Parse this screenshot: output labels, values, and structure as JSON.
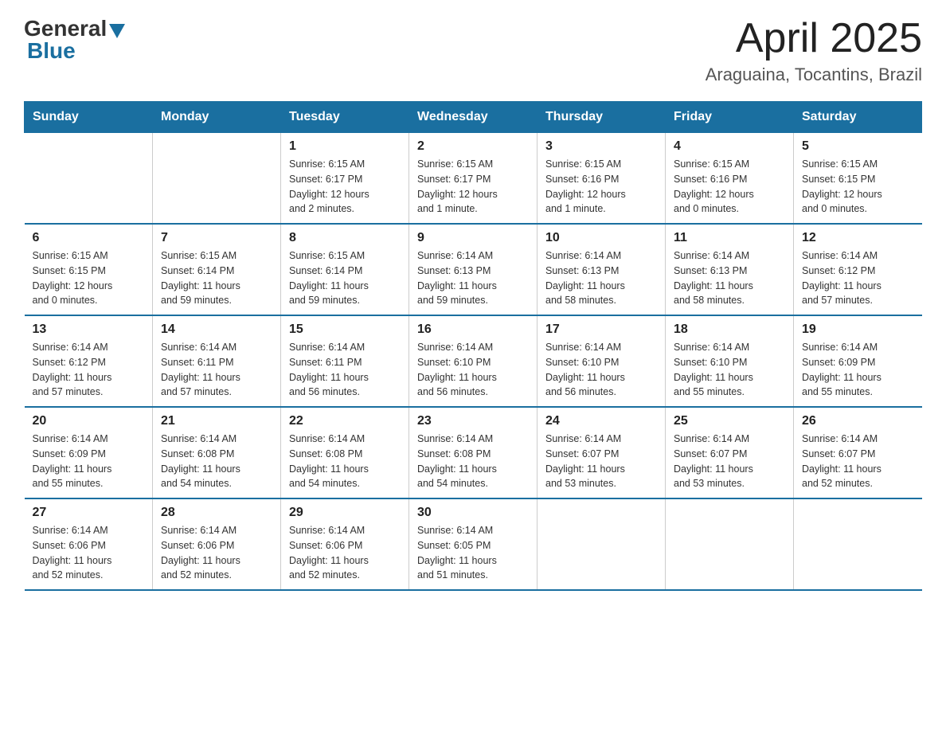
{
  "header": {
    "logo_general": "General",
    "logo_blue": "Blue",
    "month_year": "April 2025",
    "location": "Araguaina, Tocantins, Brazil"
  },
  "days_of_week": [
    "Sunday",
    "Monday",
    "Tuesday",
    "Wednesday",
    "Thursday",
    "Friday",
    "Saturday"
  ],
  "weeks": [
    [
      {
        "day": "",
        "info": ""
      },
      {
        "day": "",
        "info": ""
      },
      {
        "day": "1",
        "info": "Sunrise: 6:15 AM\nSunset: 6:17 PM\nDaylight: 12 hours\nand 2 minutes."
      },
      {
        "day": "2",
        "info": "Sunrise: 6:15 AM\nSunset: 6:17 PM\nDaylight: 12 hours\nand 1 minute."
      },
      {
        "day": "3",
        "info": "Sunrise: 6:15 AM\nSunset: 6:16 PM\nDaylight: 12 hours\nand 1 minute."
      },
      {
        "day": "4",
        "info": "Sunrise: 6:15 AM\nSunset: 6:16 PM\nDaylight: 12 hours\nand 0 minutes."
      },
      {
        "day": "5",
        "info": "Sunrise: 6:15 AM\nSunset: 6:15 PM\nDaylight: 12 hours\nand 0 minutes."
      }
    ],
    [
      {
        "day": "6",
        "info": "Sunrise: 6:15 AM\nSunset: 6:15 PM\nDaylight: 12 hours\nand 0 minutes."
      },
      {
        "day": "7",
        "info": "Sunrise: 6:15 AM\nSunset: 6:14 PM\nDaylight: 11 hours\nand 59 minutes."
      },
      {
        "day": "8",
        "info": "Sunrise: 6:15 AM\nSunset: 6:14 PM\nDaylight: 11 hours\nand 59 minutes."
      },
      {
        "day": "9",
        "info": "Sunrise: 6:14 AM\nSunset: 6:13 PM\nDaylight: 11 hours\nand 59 minutes."
      },
      {
        "day": "10",
        "info": "Sunrise: 6:14 AM\nSunset: 6:13 PM\nDaylight: 11 hours\nand 58 minutes."
      },
      {
        "day": "11",
        "info": "Sunrise: 6:14 AM\nSunset: 6:13 PM\nDaylight: 11 hours\nand 58 minutes."
      },
      {
        "day": "12",
        "info": "Sunrise: 6:14 AM\nSunset: 6:12 PM\nDaylight: 11 hours\nand 57 minutes."
      }
    ],
    [
      {
        "day": "13",
        "info": "Sunrise: 6:14 AM\nSunset: 6:12 PM\nDaylight: 11 hours\nand 57 minutes."
      },
      {
        "day": "14",
        "info": "Sunrise: 6:14 AM\nSunset: 6:11 PM\nDaylight: 11 hours\nand 57 minutes."
      },
      {
        "day": "15",
        "info": "Sunrise: 6:14 AM\nSunset: 6:11 PM\nDaylight: 11 hours\nand 56 minutes."
      },
      {
        "day": "16",
        "info": "Sunrise: 6:14 AM\nSunset: 6:10 PM\nDaylight: 11 hours\nand 56 minutes."
      },
      {
        "day": "17",
        "info": "Sunrise: 6:14 AM\nSunset: 6:10 PM\nDaylight: 11 hours\nand 56 minutes."
      },
      {
        "day": "18",
        "info": "Sunrise: 6:14 AM\nSunset: 6:10 PM\nDaylight: 11 hours\nand 55 minutes."
      },
      {
        "day": "19",
        "info": "Sunrise: 6:14 AM\nSunset: 6:09 PM\nDaylight: 11 hours\nand 55 minutes."
      }
    ],
    [
      {
        "day": "20",
        "info": "Sunrise: 6:14 AM\nSunset: 6:09 PM\nDaylight: 11 hours\nand 55 minutes."
      },
      {
        "day": "21",
        "info": "Sunrise: 6:14 AM\nSunset: 6:08 PM\nDaylight: 11 hours\nand 54 minutes."
      },
      {
        "day": "22",
        "info": "Sunrise: 6:14 AM\nSunset: 6:08 PM\nDaylight: 11 hours\nand 54 minutes."
      },
      {
        "day": "23",
        "info": "Sunrise: 6:14 AM\nSunset: 6:08 PM\nDaylight: 11 hours\nand 54 minutes."
      },
      {
        "day": "24",
        "info": "Sunrise: 6:14 AM\nSunset: 6:07 PM\nDaylight: 11 hours\nand 53 minutes."
      },
      {
        "day": "25",
        "info": "Sunrise: 6:14 AM\nSunset: 6:07 PM\nDaylight: 11 hours\nand 53 minutes."
      },
      {
        "day": "26",
        "info": "Sunrise: 6:14 AM\nSunset: 6:07 PM\nDaylight: 11 hours\nand 52 minutes."
      }
    ],
    [
      {
        "day": "27",
        "info": "Sunrise: 6:14 AM\nSunset: 6:06 PM\nDaylight: 11 hours\nand 52 minutes."
      },
      {
        "day": "28",
        "info": "Sunrise: 6:14 AM\nSunset: 6:06 PM\nDaylight: 11 hours\nand 52 minutes."
      },
      {
        "day": "29",
        "info": "Sunrise: 6:14 AM\nSunset: 6:06 PM\nDaylight: 11 hours\nand 52 minutes."
      },
      {
        "day": "30",
        "info": "Sunrise: 6:14 AM\nSunset: 6:05 PM\nDaylight: 11 hours\nand 51 minutes."
      },
      {
        "day": "",
        "info": ""
      },
      {
        "day": "",
        "info": ""
      },
      {
        "day": "",
        "info": ""
      }
    ]
  ]
}
